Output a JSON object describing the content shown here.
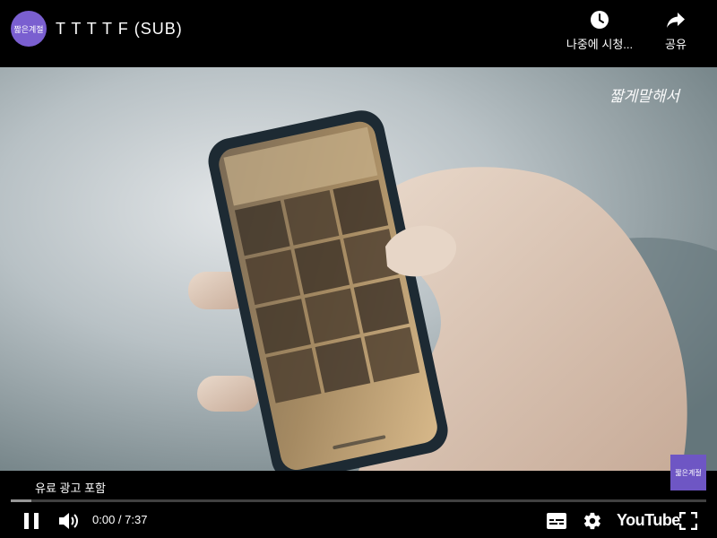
{
  "header": {
    "channel_avatar_text": "짧은계절",
    "title": "T T T T F (SUB)",
    "watch_later_label": "나중에 시청...",
    "share_label": "공유"
  },
  "video": {
    "watermark_text": "짧게말해서"
  },
  "player": {
    "paid_promotion_label": "유료 광고 포함",
    "promo_thumbnail_text": "짧은계절",
    "progress_buffered_fraction": 0.03,
    "time_display": "0:00 / 7:37",
    "brand_label": "YouTube",
    "state": "playing"
  },
  "icons": {
    "watch_later": "clock-icon",
    "share": "share-arrow-icon",
    "pause": "pause-icon",
    "volume": "volume-icon",
    "captions": "captions-icon",
    "settings": "gear-icon",
    "fullscreen": "fullscreen-icon"
  }
}
